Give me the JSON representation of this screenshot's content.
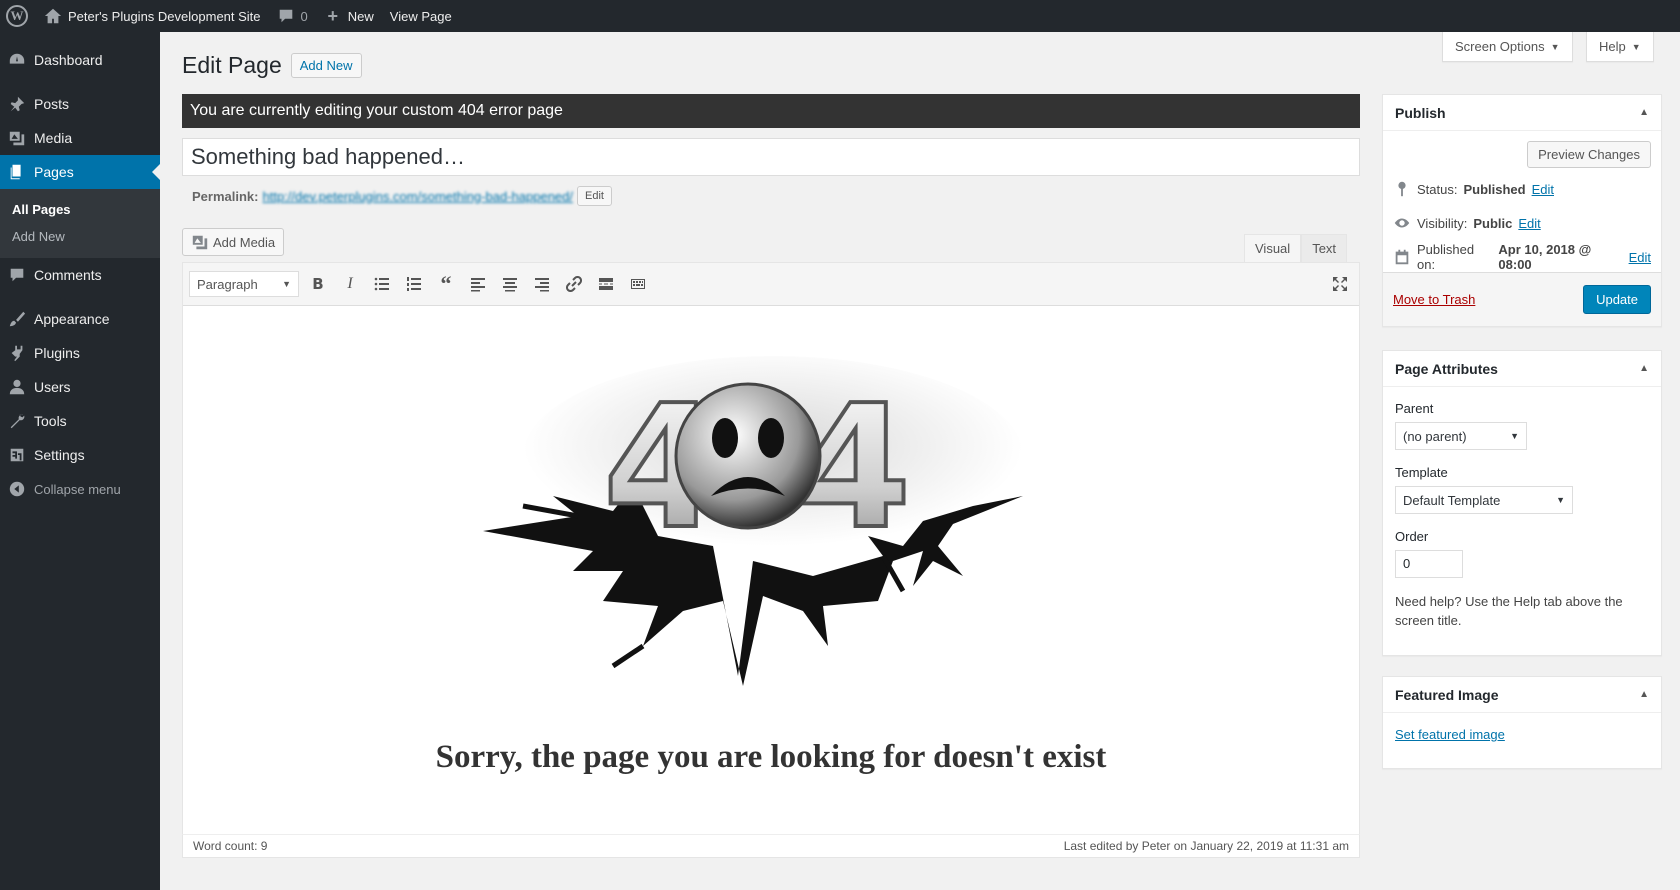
{
  "adminbar": {
    "site_name": "Peter's Plugins Development Site",
    "comments_count": "0",
    "new_label": "New",
    "view_label": "View Page"
  },
  "sidebar": {
    "items": [
      {
        "label": "Dashboard",
        "icon": "dashboard-icon"
      },
      {
        "label": "Posts",
        "icon": "pin-icon"
      },
      {
        "label": "Media",
        "icon": "media-icon"
      },
      {
        "label": "Pages",
        "icon": "pages-icon"
      },
      {
        "label": "Comments",
        "icon": "comment-icon"
      },
      {
        "label": "Appearance",
        "icon": "brush-icon"
      },
      {
        "label": "Plugins",
        "icon": "plugin-icon"
      },
      {
        "label": "Users",
        "icon": "user-icon"
      },
      {
        "label": "Tools",
        "icon": "wrench-icon"
      },
      {
        "label": "Settings",
        "icon": "settings-icon"
      }
    ],
    "submenu": [
      "All Pages",
      "Add New"
    ],
    "collapse_label": "Collapse menu"
  },
  "screen_meta": {
    "screen_options": "Screen Options",
    "help": "Help"
  },
  "main": {
    "title": "Edit Page",
    "add_new": "Add New",
    "notice": "You are currently editing your custom 404 error page",
    "page_title": "Something bad happened…",
    "permalink_label": "Permalink:",
    "permalink_url": "http://dev.peterplugins.com/something-bad-happened/",
    "permalink_edit": "Edit",
    "add_media": "Add Media",
    "tab_visual": "Visual",
    "tab_text": "Text",
    "format_select": "Paragraph",
    "content_heading": "Sorry, the page you are looking for doesn't exist",
    "word_count": "Word count: 9",
    "last_edited": "Last edited by Peter on January 22, 2019 at 11:31 am"
  },
  "publish": {
    "title": "Publish",
    "preview": "Preview Changes",
    "status_label": "Status:",
    "status_value": "Published",
    "visibility_label": "Visibility:",
    "visibility_value": "Public",
    "published_label": "Published on:",
    "published_value": "Apr 10, 2018 @ 08:00",
    "edit": "Edit",
    "trash": "Move to Trash",
    "update": "Update"
  },
  "attributes": {
    "title": "Page Attributes",
    "parent_label": "Parent",
    "parent_value": "(no parent)",
    "template_label": "Template",
    "template_value": "Default Template",
    "order_label": "Order",
    "order_value": "0",
    "help": "Need help? Use the Help tab above the screen title."
  },
  "featured": {
    "title": "Featured Image",
    "link": "Set featured image"
  },
  "colors": {
    "accent": "#0073aa",
    "primary_button": "#0085ba",
    "adminbar": "#23282d",
    "trash": "#a00"
  }
}
